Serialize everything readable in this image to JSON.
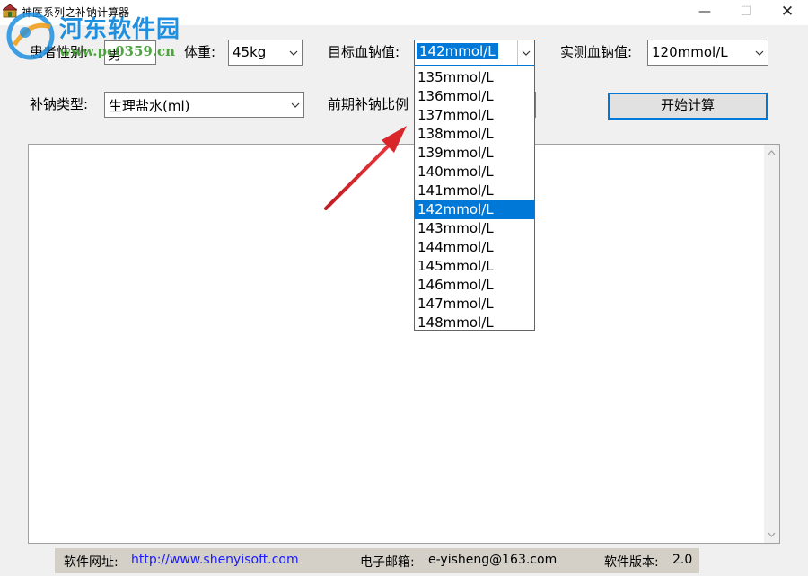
{
  "window": {
    "title": "神医系列之补钠计算器",
    "controls": {
      "minimize": "—",
      "maximize": "☐",
      "close": "✕"
    }
  },
  "watermark": {
    "brand": "河东软件园",
    "url": "www.pc0359.cn"
  },
  "form": {
    "gender": {
      "label": "患者性别:",
      "value": "男"
    },
    "weight": {
      "label": "体重:",
      "value": "45kg"
    },
    "target_sodium": {
      "label": "目标血钠值:",
      "value": "142mmol/L"
    },
    "measured_sodium": {
      "label": "实测血钠值:",
      "value": "120mmol/L"
    },
    "sodium_type": {
      "label": "补钠类型:",
      "value": "生理盐水(ml)"
    },
    "early_ratio": {
      "label": "前期补钠比例"
    },
    "calculate_button": "开始计算"
  },
  "dropdown": {
    "options": [
      "135mmol/L",
      "136mmol/L",
      "137mmol/L",
      "138mmol/L",
      "139mmol/L",
      "140mmol/L",
      "141mmol/L",
      "142mmol/L",
      "143mmol/L",
      "144mmol/L",
      "145mmol/L",
      "146mmol/L",
      "147mmol/L",
      "148mmol/L"
    ],
    "selected_index": 7
  },
  "statusbar": {
    "website_label": "软件网址:",
    "website": "http://www.shenyisoft.com",
    "email_label": "电子邮箱:",
    "email": "e-yisheng@163.com",
    "version_label": "软件版本:",
    "version": "2.0"
  },
  "colors": {
    "accent": "#0078d7",
    "annotation_arrow": "#d9262b",
    "statusbar": "#d4d0c8"
  }
}
